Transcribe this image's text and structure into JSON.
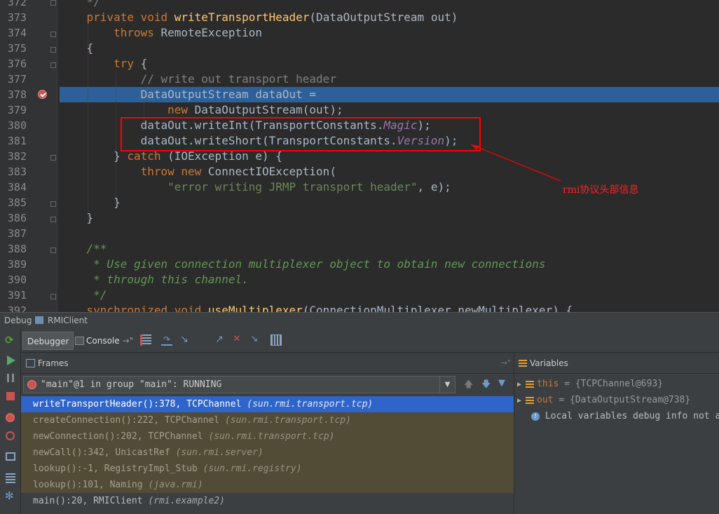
{
  "editor": {
    "line_numbers": [
      "372",
      "373",
      "374",
      "375",
      "376",
      "377",
      "378",
      "379",
      "380",
      "381",
      "382",
      "383",
      "384",
      "385",
      "386",
      "387",
      "388",
      "389",
      "390",
      "391",
      "392"
    ],
    "code": {
      "l372": "*/",
      "l373_kw": "private void ",
      "l373_fn": "writeTransportHeader",
      "l373_rest": "(DataOutputStream out)",
      "l374_kw": "throws ",
      "l374_rest": "RemoteException",
      "l375": "{",
      "l376_kw": "try ",
      "l376_rest": "{",
      "l377": "// write out transport header",
      "l378": "DataOutputStream dataOut =",
      "l379_kw": "new ",
      "l379_rest": "DataOutputStream(out);",
      "l380_a": "dataOut.writeInt(TransportConstants.",
      "l380_it": "Magic",
      "l380_b": ");",
      "l381_a": "dataOut.writeShort(TransportConstants.",
      "l381_it": "Version",
      "l381_b": ");",
      "l382_a": "} ",
      "l382_kw": "catch ",
      "l382_rest": "(IOException e) {",
      "l383_kw": "throw new ",
      "l383_rest": "ConnectIOException(",
      "l384_str": "\"error writing JRMP transport header\"",
      "l384_rest": ", e);",
      "l385": "}",
      "l386": "}",
      "l388": "/**",
      "l389": " * Use given connection multiplexer object to obtain new connections",
      "l390": " * through this channel.",
      "l391": " */",
      "l392_kw": "synchronized void ",
      "l392_fn": "useMultiplexer",
      "l392_rest": "(ConnectionMultiplexer newMultiplexer) {"
    },
    "annotation": "rmi协议头部信息",
    "highlight_color": "#ff0000"
  },
  "debug_bar": {
    "label": "Debug",
    "config": "RMIClient"
  },
  "tabs": {
    "debugger": "Debugger",
    "console": "Console"
  },
  "frames": {
    "header": "Frames",
    "thread": "\"main\"@1 in group \"main\": RUNNING",
    "rows": [
      {
        "method": "writeTransportHeader():378, TCPChannel ",
        "pkg": "(sun.rmi.transport.tcp)"
      },
      {
        "method": "createConnection():222, TCPChannel ",
        "pkg": "(sun.rmi.transport.tcp)"
      },
      {
        "method": "newConnection():202, TCPChannel ",
        "pkg": "(sun.rmi.transport.tcp)"
      },
      {
        "method": "newCall():342, UnicastRef ",
        "pkg": "(sun.rmi.server)"
      },
      {
        "method": "lookup():-1, RegistryImpl_Stub ",
        "pkg": "(sun.rmi.registry)"
      },
      {
        "method": "lookup():101, Naming ",
        "pkg": "(java.rmi)"
      },
      {
        "method": "main():20, RMIClient ",
        "pkg": "(rmi.example2)"
      }
    ]
  },
  "variables": {
    "header": "Variables",
    "rows": [
      {
        "name": "this",
        "value": " = {TCPChannel@693}"
      },
      {
        "name": "out",
        "value": " = {DataOutputStream@738}"
      }
    ],
    "info": "Local variables debug info not a"
  }
}
